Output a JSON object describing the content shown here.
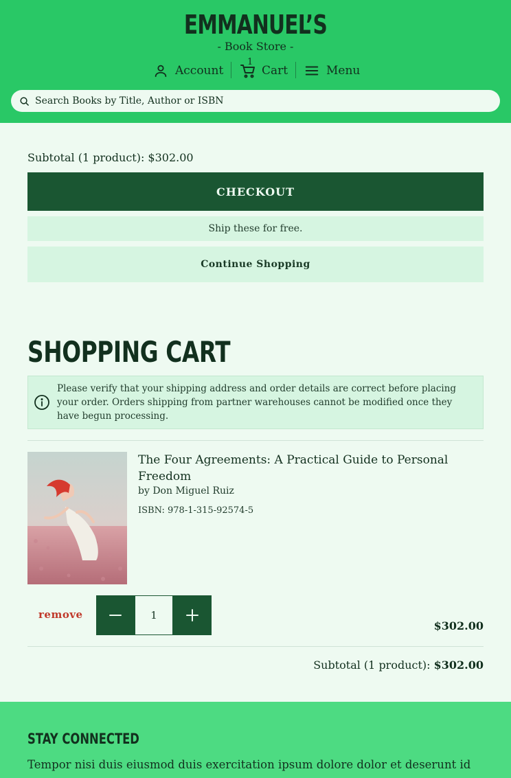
{
  "header": {
    "logo_title": "EMMANUEL’S",
    "logo_subtitle": "- Book Store -",
    "nav": {
      "account_label": "Account",
      "cart_label": "Cart",
      "cart_count": "1",
      "menu_label": "Menu"
    },
    "search": {
      "placeholder": "Search Books by Title, Author or ISBN",
      "value": ""
    }
  },
  "summary": {
    "subtotal_text": "Subtotal (1 product): $302.00",
    "checkout_label": "CHECKOUT",
    "ship_free_text": "Ship these for free.",
    "continue_label": "Continue Shopping"
  },
  "cart": {
    "title": "SHOPPING CART",
    "notice": "Please verify that your shipping address and order details are correct before placing your order. Orders shipping from partner warehouses cannot be modified once they have begun processing.",
    "items": [
      {
        "title": "The Four Agreements: A Practical Guide to Personal Freedom",
        "author": "by Don Miguel Ruiz",
        "isbn": "ISBN: 978-1-315-92574-5",
        "remove_label": "remove",
        "quantity": "1",
        "price": "$302.00"
      }
    ],
    "subtotal_label": "Subtotal (1 product):",
    "subtotal_value": "$302.00"
  },
  "footer": {
    "title": "STAY CONNECTED",
    "text": "Tempor nisi duis eiusmod duis exercitation ipsum dolore dolor et deserunt id"
  },
  "colors": {
    "header_bg": "#29c866",
    "primary_dark": "#1a5632",
    "light_green": "#d6f5e1",
    "page_bg": "#eefaf1",
    "footer_bg": "#4ddb82",
    "remove_red": "#c0392b"
  },
  "icons": {
    "account": "user-icon",
    "cart": "cart-icon",
    "menu": "menu-icon",
    "search": "search-icon",
    "notice": "info-icon",
    "qty_minus": "minus-icon",
    "qty_plus": "plus-icon"
  }
}
